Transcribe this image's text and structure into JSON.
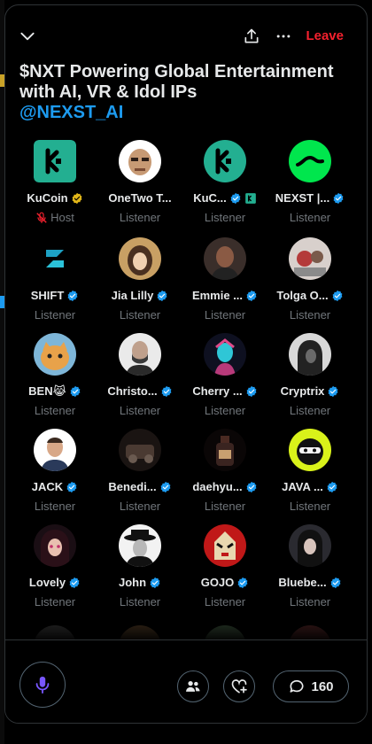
{
  "header": {
    "leave_label": "Leave"
  },
  "space": {
    "title": "$NXT Powering Global Entertainment with AI, VR & Idol IPs",
    "handle": "@NEXST_AI"
  },
  "participants": [
    {
      "name": "KuCoin",
      "role": "Host",
      "badge": "gold",
      "avatar": "kucoin-logo-avatar",
      "host_muted": true
    },
    {
      "name": "OneTwo T...",
      "role": "Listener",
      "badge": "none",
      "avatar": "cartoon-face-avatar"
    },
    {
      "name": "KuC...",
      "role": "Listener",
      "badge": "blue+square",
      "avatar": "kucoin-logo-avatar"
    },
    {
      "name": "NEXST |...",
      "role": "Listener",
      "badge": "blue",
      "avatar": "nexst-logo-avatar"
    },
    {
      "name": "SHIFT",
      "role": "Listener",
      "badge": "blue",
      "avatar": "shift-logo-avatar"
    },
    {
      "name": "Jia Lilly",
      "role": "Listener",
      "badge": "blue",
      "avatar": "anime-girl-avatar"
    },
    {
      "name": "Emmie ...",
      "role": "Listener",
      "badge": "blue",
      "avatar": "portrait-avatar"
    },
    {
      "name": "Tolga O...",
      "role": "Listener",
      "badge": "blue",
      "avatar": "photo-avatar"
    },
    {
      "name": "BEN😹",
      "role": "Listener",
      "badge": "blue",
      "avatar": "cat-avatar"
    },
    {
      "name": "Christo...",
      "role": "Listener",
      "badge": "blue",
      "avatar": "man-avatar"
    },
    {
      "name": "Cherry ...",
      "role": "Listener",
      "badge": "blue",
      "avatar": "cyber-avatar"
    },
    {
      "name": "Cryptrix",
      "role": "Listener",
      "badge": "blue",
      "avatar": "hooded-avatar"
    },
    {
      "name": "JACK",
      "role": "Listener",
      "badge": "blue",
      "avatar": "man-smiling-avatar"
    },
    {
      "name": "Benedi...",
      "role": "Listener",
      "badge": "blue",
      "avatar": "machine-avatar"
    },
    {
      "name": "daehyu...",
      "role": "Listener",
      "badge": "blue",
      "avatar": "bottle-avatar"
    },
    {
      "name": "JAVA ...",
      "role": "Listener",
      "badge": "blue",
      "avatar": "ninja-avatar"
    },
    {
      "name": "Lovely",
      "role": "Listener",
      "badge": "blue",
      "avatar": "anime-girl-dark-avatar"
    },
    {
      "name": "John",
      "role": "Listener",
      "badge": "blue",
      "avatar": "hat-man-avatar"
    },
    {
      "name": "GOJO",
      "role": "Listener",
      "badge": "blue",
      "avatar": "red-mask-avatar"
    },
    {
      "name": "Bluebe...",
      "role": "Listener",
      "badge": "blue",
      "avatar": "anime-dark-avatar"
    }
  ],
  "footer": {
    "comment_count": "160"
  },
  "colors": {
    "accent": "#1d9bf0",
    "leave": "#f4212e",
    "mic": "#7856ff",
    "gold": "#e2b719",
    "kucoin": "#23af91",
    "nexst": "#00e64d"
  }
}
